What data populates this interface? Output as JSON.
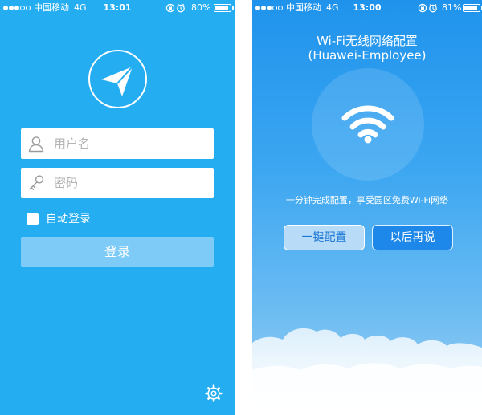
{
  "left_screen": {
    "status_bar": {
      "carrier": "中国移动",
      "network": "4G",
      "time": "13:01",
      "battery": "80%",
      "battery_level": 0.8
    },
    "logo_icon": "paper-plane-icon",
    "username": {
      "icon": "user-icon",
      "placeholder": "用户名"
    },
    "password": {
      "icon": "key-icon",
      "placeholder": "密码"
    },
    "remember_me": {
      "label": "自动登录",
      "checked": false
    },
    "login_button": "登录",
    "settings_icon": "gear-icon"
  },
  "right_screen": {
    "status_bar": {
      "carrier": "中国移动",
      "network": "4G",
      "time": "13:00",
      "battery": "81%",
      "battery_level": 0.81
    },
    "title_line1": "Wi-Fi无线网络配置",
    "title_line2": "(Huawei-Employee)",
    "wifi_icon": "wifi-icon",
    "tagline": "一分钟完成配置，享受园区免费Wi-Fi网络",
    "one_key_button": "一键配置",
    "later_button": "以后再说"
  },
  "colors": {
    "left_background": "#25adf2",
    "right_background_top": "#1f93ec",
    "login_button": "#7dcbf6",
    "one_key_text": "#1b77d4",
    "later_button": "#1d88ea"
  }
}
